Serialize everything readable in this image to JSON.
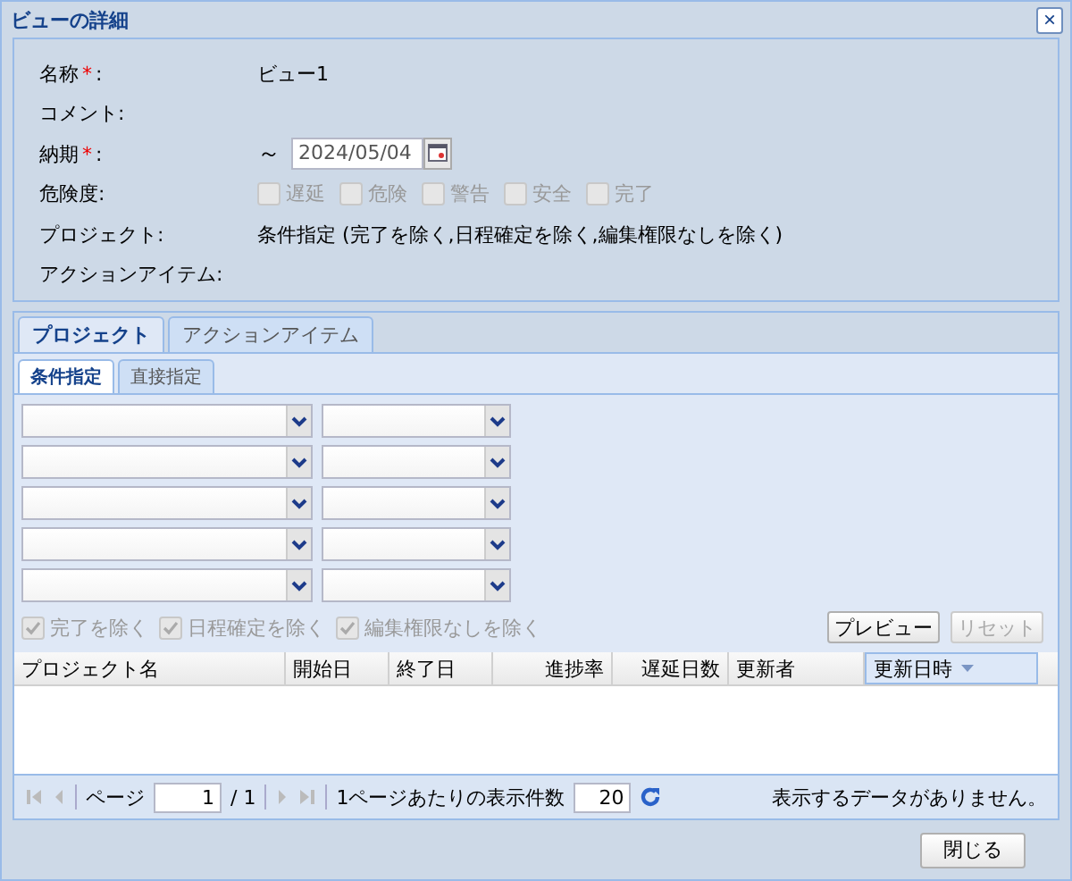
{
  "window": {
    "title": "ビューの詳細",
    "close_symbol": "×"
  },
  "details": {
    "fields": [
      {
        "kind": "text",
        "label": "名称",
        "required": true,
        "value": "ビュー1"
      },
      {
        "kind": "text",
        "label": "コメント:",
        "required": false
      },
      {
        "kind": "date",
        "label": "納期",
        "required": true,
        "prefix": "～",
        "value": "2024/05/04"
      },
      {
        "kind": "checks",
        "label": "危険度:",
        "required": false,
        "options": [
          {
            "label": "遅延",
            "checked": false,
            "disabled": true
          },
          {
            "label": "危険",
            "checked": false,
            "disabled": true
          },
          {
            "label": "警告",
            "checked": false,
            "disabled": true
          },
          {
            "label": "安全",
            "checked": false,
            "disabled": true
          },
          {
            "label": "完了",
            "checked": false,
            "disabled": true
          }
        ]
      },
      {
        "kind": "text",
        "label": "プロジェクト:",
        "required": false,
        "value": "条件指定 (完了を除く,日程確定を除く,編集権限なしを除く)"
      },
      {
        "kind": "text",
        "label": "アクションアイテム:",
        "required": false
      }
    ],
    "required_mark": "*",
    "colon": ":"
  },
  "tabs": [
    {
      "label": "プロジェクト",
      "selected": true
    },
    {
      "label": "アクションアイテム",
      "selected": false
    }
  ],
  "subtabs": [
    {
      "label": "条件指定",
      "selected": true
    },
    {
      "label": "直接指定",
      "selected": false
    }
  ],
  "filter_rows": [
    {
      "kind": "combo_pair"
    },
    {
      "kind": "combo_pair"
    },
    {
      "kind": "combo_pair"
    },
    {
      "kind": "combo_pair"
    },
    {
      "kind": "combo_pair"
    }
  ],
  "exclude_options": [
    {
      "label": "完了を除く",
      "checked": true,
      "disabled": true
    },
    {
      "label": "日程確定を除く",
      "checked": true,
      "disabled": true
    },
    {
      "label": "編集権限なしを除く",
      "checked": true,
      "disabled": true
    }
  ],
  "filter_buttons": [
    {
      "label": "プレビュー",
      "disabled": false
    },
    {
      "label": "リセット",
      "disabled": true
    }
  ],
  "table": {
    "columns": [
      {
        "label": "プロジェクト名",
        "sorted": false
      },
      {
        "label": "開始日",
        "sorted": false
      },
      {
        "label": "終了日",
        "sorted": false
      },
      {
        "label": "進捗率",
        "sorted": false
      },
      {
        "label": "遅延日数",
        "sorted": false
      },
      {
        "label": "更新者",
        "sorted": false
      },
      {
        "label": "更新日時",
        "sorted": true
      }
    ]
  },
  "pager": {
    "page_label": "ページ",
    "page": "1",
    "total": "/ 1",
    "per_page_label": "1ページあたりの表示件数",
    "per_page": "20",
    "message": "表示するデータがありません。"
  },
  "buttons": [
    "閉じる"
  ]
}
